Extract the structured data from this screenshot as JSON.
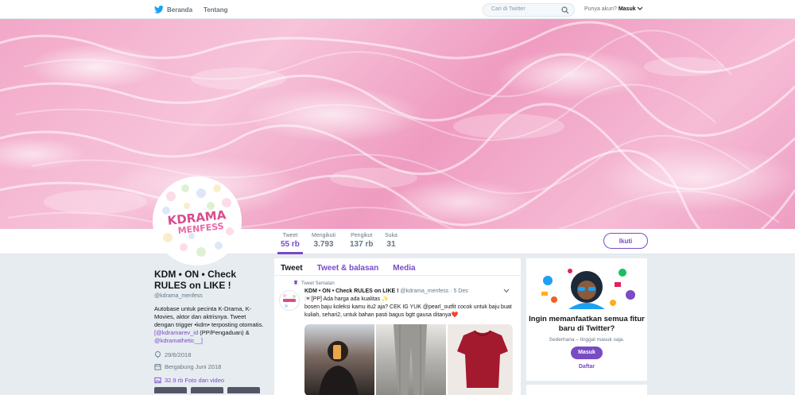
{
  "nav": {
    "home_label": "Beranda",
    "about_label": "Tentang",
    "search_placeholder": "Cari di Twitter",
    "account_prompt": "Punya akun?",
    "login_label": "Masuk"
  },
  "profile": {
    "name": "KDM • ON • Check RULES on LIKE !",
    "handle": "@kdrama_menfess",
    "bio_text": "Autobase untuk pecinta K-Drama, K-Movies, aktor dan aktrisnya. Tweet dengan trigger •kdm• terposting otomatis. ",
    "bio_link1": "[@kdramarev_id",
    "bio_mid": " (PP/Pengaduan) & ",
    "bio_link2": "@kdramathetic__]",
    "birthday": "29/6/2018",
    "joined": "Bergabung Juni 2018",
    "media_link": "32.9 rb Foto dan video",
    "avatar_text_line1": "KDRAMA",
    "avatar_text_line2": "MENFESS"
  },
  "stats": [
    {
      "label": "Tweet",
      "value": "55 rb"
    },
    {
      "label": "Mengikuti",
      "value": "3.793"
    },
    {
      "label": "Pengikut",
      "value": "137 rb"
    },
    {
      "label": "Suka",
      "value": "31"
    }
  ],
  "follow_label": "Ikuti",
  "timeline": {
    "tabs": [
      "Tweet",
      "Tweet & balasan",
      "Media"
    ],
    "pinned_label": "Tweet Sematan",
    "tweet": {
      "author": "KDM • ON • Check RULES on LIKE !",
      "handle": "@kdrama_menfess",
      "date": "· 5 Des",
      "line1": "💌[PP] Ada harga ada kualitas ✨",
      "line2": "bosen baju koleksi kamu itu2 aja? CEK IG YUK @pearl_outfit cocok untuk baju buat kuliah, sehari2, untuk bahan pasti bagus bgtt gausa ditanya❤️"
    }
  },
  "signup_card": {
    "title": "Ingin memanfaatkan semua fitur baru di Twitter?",
    "subtitle": "Sederhana – tinggal masuk saja.",
    "login_button": "Masuk",
    "signup_link": "Daftar"
  },
  "colors": {
    "accent": "#794bc4",
    "twitter_blue": "#1da1f2",
    "banner_pink": "#f2a7c8"
  },
  "icons": [
    "twitter-bird-icon",
    "home-icon",
    "search-icon",
    "chevron-down-icon",
    "pin-icon",
    "balloon-icon",
    "calendar-icon",
    "photo-icon"
  ]
}
